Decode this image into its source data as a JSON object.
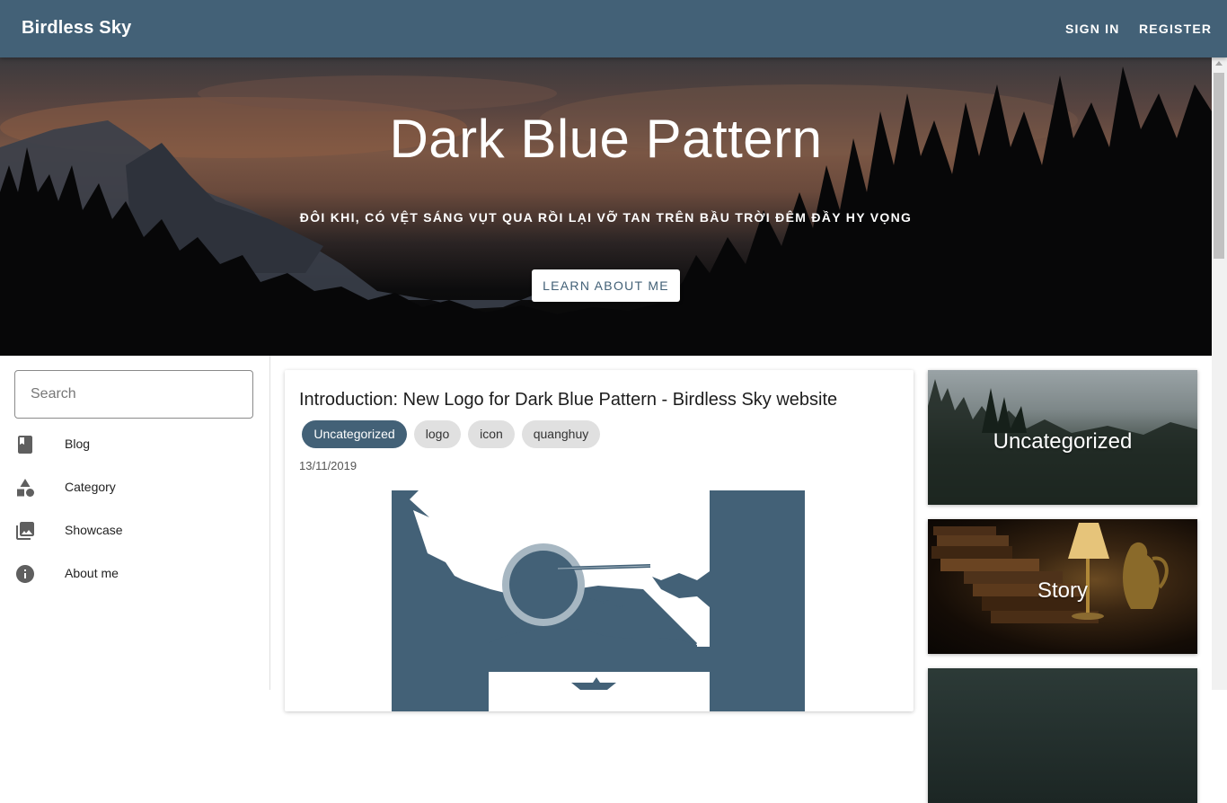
{
  "appbar": {
    "brand": "Birdless Sky",
    "sign_in": "SIGN IN",
    "register": "REGISTER",
    "color": "#436177"
  },
  "hero": {
    "title": "Dark Blue Pattern",
    "subtitle": "ĐÔI KHI, CÓ VỆT SÁNG VỤT QUA RỒI LẠI VỠ TAN TRÊN BẦU TRỜI ĐÊM ĐẦY HY VỌNG",
    "button": "LEARN ABOUT ME"
  },
  "search": {
    "placeholder": "Search"
  },
  "sidebar": {
    "items": [
      {
        "label": "Blog",
        "icon": "book-icon"
      },
      {
        "label": "Category",
        "icon": "shapes-icon"
      },
      {
        "label": "Showcase",
        "icon": "photo-library-icon"
      },
      {
        "label": "About me",
        "icon": "info-icon"
      }
    ]
  },
  "post": {
    "title": "Introduction: New Logo for Dark Blue Pattern - Birdless Sky website",
    "tags": [
      "Uncategorized",
      "logo",
      "icon",
      "quanghuy"
    ],
    "date": "13/11/2019"
  },
  "categories": [
    {
      "label": "Uncategorized"
    },
    {
      "label": "Story"
    },
    {
      "label": ""
    }
  ]
}
